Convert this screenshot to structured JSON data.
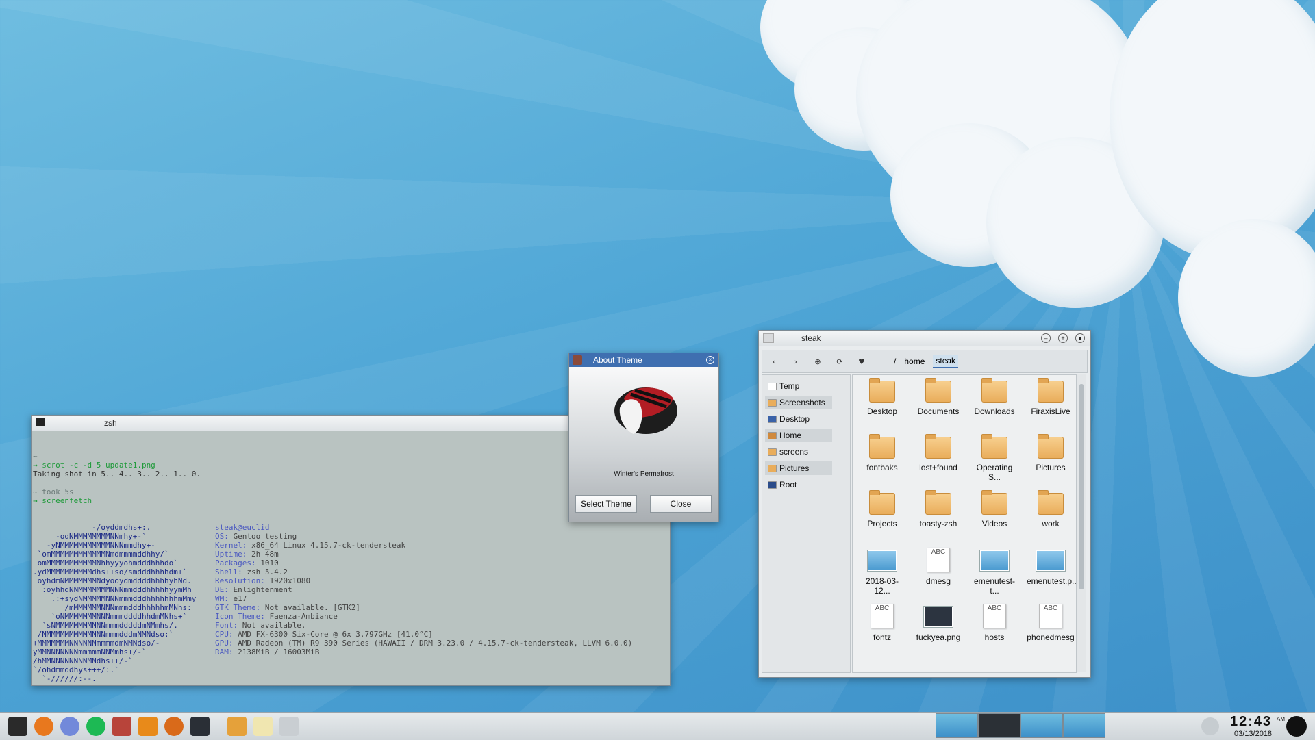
{
  "terminal": {
    "title": "zsh",
    "lines": [
      "~",
      "→ scrot -c -d 5 update1.png",
      "Taking shot in 5.. 4.. 3.. 2.. 1.. 0.",
      "",
      "~ took 5s",
      "→ screenfetch"
    ],
    "fetch_logo": [
      "             -/oyddmdhs+:.",
      "     -odNMMMMMMMMNNmhy+-`",
      "   -yNMMMMMMMMMMMNNNmmdhy+-",
      " `omMMMMMMMMMMMMNmdmmmmddhhy/`",
      " omMMMMMMMMMMMNhhyyyohmdddhhhdo`",
      ".ydMMMMMMMMMMdhs++so/smdddhhhhdm+`",
      " oyhdmNMMMMMMMNdyooydmddddhhhhyhNd.",
      "  :oyhhdNNMMMMMMMNNNmmdddhhhhhyymMh",
      "    .:+sydNMMMMMNNNmmmdddhhhhhhhmMmy",
      "       /mMMMMMMNNNmmmdddhhhhhmMNhs:",
      "    `oNMMMMMMMNNNmmmddddhhdmMNhs+`",
      "  `sNMMMMMMMMNNNmmmdddddmNMmhs/.",
      " /NMMMMMMMMMMNNNmmmdddmNMNdso:`",
      "+MMMMMMMNNNNNNmmmmdmNMNdso/-",
      "yMMNNNNNNNmmmmmNNMmhs+/-`",
      "/hMMNNNNNNNNMNdhs++/-`",
      "`/ohdmmddhys+++/:.`",
      "  `-//////:--."
    ],
    "fetch_info": [
      {
        "key": "",
        "val": "steak@euclid"
      },
      {
        "key": "OS: ",
        "val": "Gentoo testing"
      },
      {
        "key": "Kernel: ",
        "val": "x86_64 Linux 4.15.7-ck-tendersteak"
      },
      {
        "key": "Uptime: ",
        "val": "2h 48m"
      },
      {
        "key": "Packages: ",
        "val": "1010"
      },
      {
        "key": "Shell: ",
        "val": "zsh 5.4.2"
      },
      {
        "key": "Resolution: ",
        "val": "1920x1080"
      },
      {
        "key": "DE: ",
        "val": "Enlightenment"
      },
      {
        "key": "WM: ",
        "val": "e17"
      },
      {
        "key": "GTK Theme: ",
        "val": "Not available. [GTK2]"
      },
      {
        "key": "Icon Theme: ",
        "val": "Faenza-Ambiance"
      },
      {
        "key": "Font: ",
        "val": "Not available."
      },
      {
        "key": "CPU: ",
        "val": "AMD FX-6300 Six-Core @ 6x 3.797GHz [41.0°C]"
      },
      {
        "key": "GPU: ",
        "val": "AMD Radeon (TM) R9 390 Series (HAWAII / DRM 3.23.0 / 4.15.7-ck-tendersteak, LLVM 6.0.0)"
      },
      {
        "key": "RAM: ",
        "val": "2138MiB / 16003MiB"
      }
    ],
    "last_lines": [
      "~",
      "→ scrot -c -d 5 update1.png",
      "Taking shot in 5.. 4.. 3.. 2.. 1.. "
    ]
  },
  "about": {
    "title": "About Theme",
    "theme_name": "Winter's Permafrost",
    "select_label": "Select Theme",
    "close_label": "Close"
  },
  "files": {
    "title": "steak",
    "path": [
      "/",
      "home",
      "steak"
    ],
    "sidebar": [
      {
        "label": "Temp",
        "icon": "file-icon"
      },
      {
        "label": "Screenshots",
        "icon": "folder-icon"
      },
      {
        "label": "Desktop",
        "icon": "desktop-icon"
      },
      {
        "label": "Home",
        "icon": "home-icon"
      },
      {
        "label": "screens",
        "icon": "folder-icon"
      },
      {
        "label": "Pictures",
        "icon": "folder-icon"
      },
      {
        "label": "Root",
        "icon": "drive-icon"
      }
    ],
    "items": [
      {
        "label": "Desktop",
        "kind": "folder"
      },
      {
        "label": "Documents",
        "kind": "folder"
      },
      {
        "label": "Downloads",
        "kind": "folder"
      },
      {
        "label": "FiraxisLive",
        "kind": "folder"
      },
      {
        "label": "fontbaks",
        "kind": "folder"
      },
      {
        "label": "lost+found",
        "kind": "folder"
      },
      {
        "label": "Operating S...",
        "kind": "folder"
      },
      {
        "label": "Pictures",
        "kind": "folder"
      },
      {
        "label": "Projects",
        "kind": "folder"
      },
      {
        "label": "toasty-zsh",
        "kind": "folder"
      },
      {
        "label": "Videos",
        "kind": "folder"
      },
      {
        "label": "work",
        "kind": "folder"
      },
      {
        "label": "2018-03-12...",
        "kind": "image"
      },
      {
        "label": "dmesg",
        "kind": "text"
      },
      {
        "label": "emenutest-t...",
        "kind": "image"
      },
      {
        "label": "emenutest.p...",
        "kind": "image"
      },
      {
        "label": "fontz",
        "kind": "text"
      },
      {
        "label": "fuckyea.png",
        "kind": "dark"
      },
      {
        "label": "hosts",
        "kind": "text"
      },
      {
        "label": "phonedmesg",
        "kind": "text"
      }
    ],
    "text_icon_label": "ABC"
  },
  "clock": {
    "time": "12:43",
    "ampm": "AM",
    "date": "03/13/2018"
  },
  "taskbar": {
    "launchers": [
      "terminal-icon",
      "blender-icon",
      "discord-icon",
      "spotify-icon",
      "game-icon",
      "vlc-icon",
      "firefox-icon",
      "steam-icon",
      "paint-icon",
      "editor-icon",
      "files-icon"
    ]
  },
  "colors": {
    "titlebar_active": "#3f6fb0",
    "desktop_blue": "#4fa6d6",
    "folder": "#e9ad5b"
  }
}
